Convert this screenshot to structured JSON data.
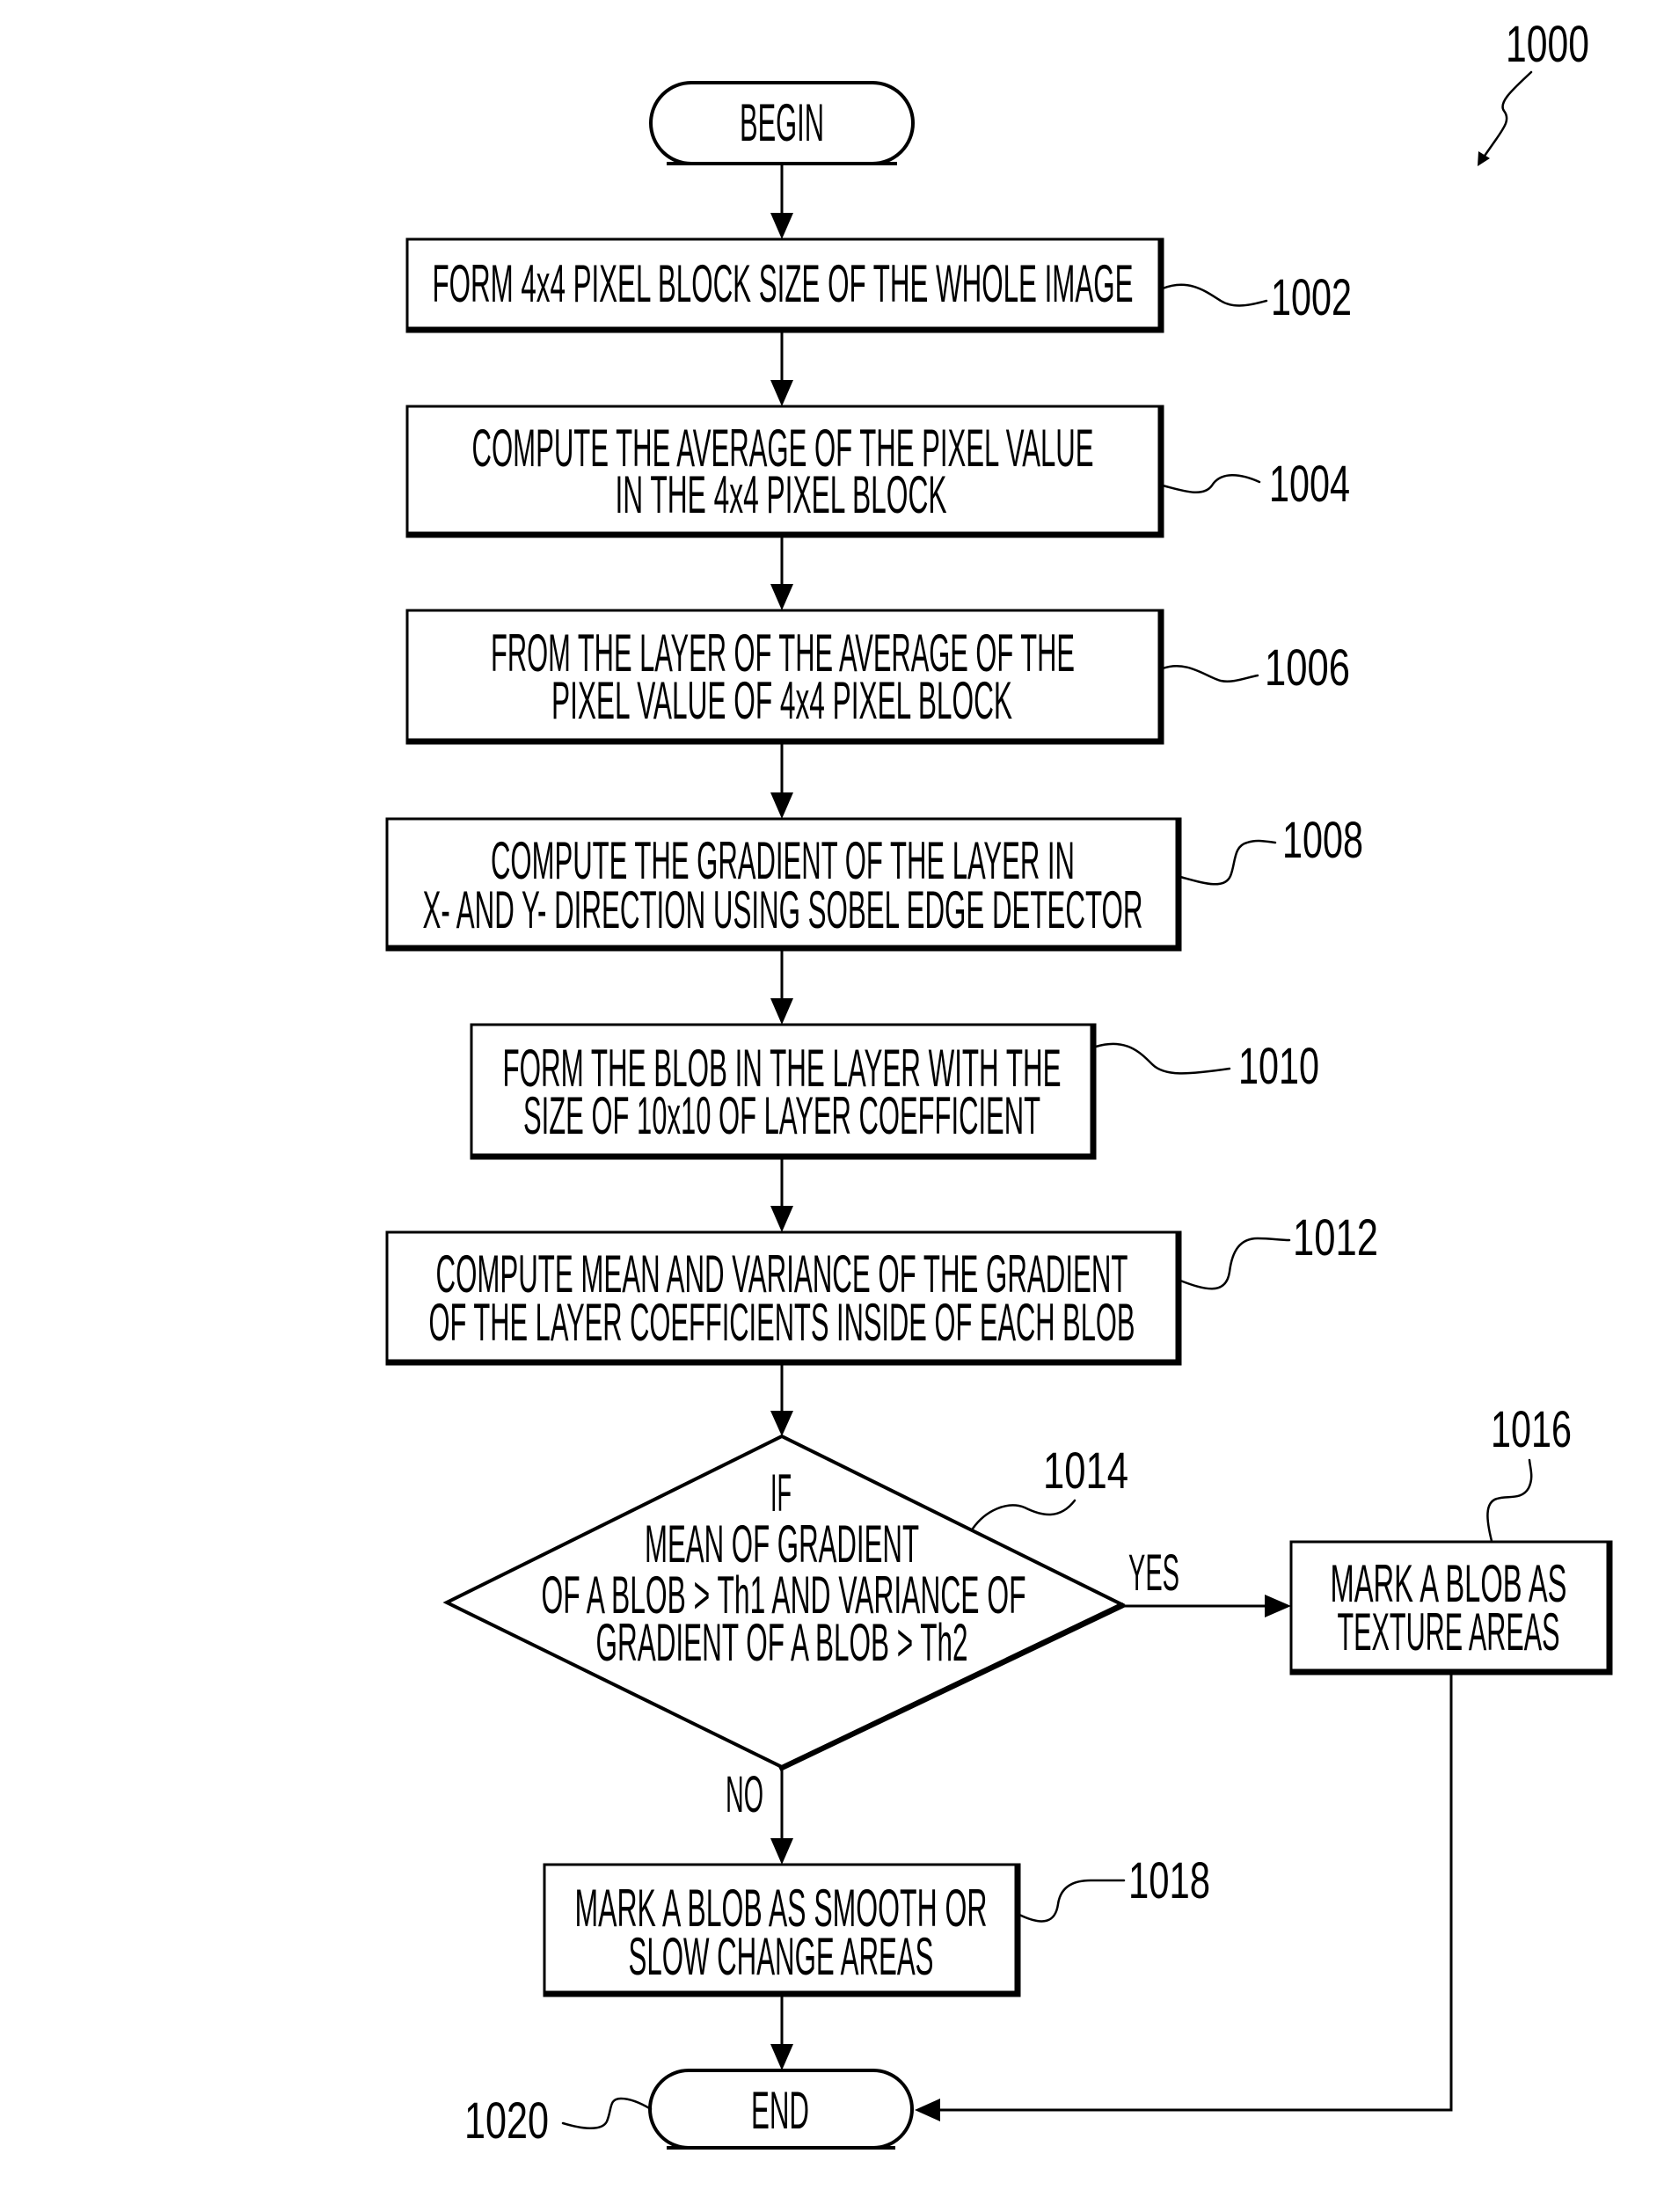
{
  "figure": {
    "reference": "1000",
    "colors": {
      "ink": "#000000",
      "paper": "#ffffff"
    }
  },
  "begin": {
    "label": "BEGIN"
  },
  "end": {
    "label": "END",
    "ref": "1020"
  },
  "steps": [
    {
      "ref": "1002",
      "lines": [
        "FORM 4x4 PIXEL BLOCK SIZE OF THE WHOLE IMAGE"
      ]
    },
    {
      "ref": "1004",
      "lines": [
        "COMPUTE THE AVERAGE OF THE PIXEL VALUE",
        "IN THE 4x4 PIXEL BLOCK"
      ]
    },
    {
      "ref": "1006",
      "lines": [
        "FROM THE LAYER OF THE AVERAGE OF THE",
        "PIXEL VALUE OF 4x4 PIXEL BLOCK"
      ]
    },
    {
      "ref": "1008",
      "lines": [
        "COMPUTE THE GRADIENT OF THE LAYER IN",
        "X- AND Y- DIRECTION USING SOBEL EDGE DETECTOR"
      ]
    },
    {
      "ref": "1010",
      "lines": [
        "FORM THE BLOB IN THE LAYER WITH THE",
        "SIZE OF 10x10 OF LAYER COEFFICIENT"
      ]
    },
    {
      "ref": "1012",
      "lines": [
        "COMPUTE MEAN AND VARIANCE OF THE GRADIENT",
        "OF THE LAYER COEFFICIENTS INSIDE OF EACH BLOB"
      ]
    }
  ],
  "decision": {
    "ref": "1014",
    "lines": [
      "IF",
      "MEAN OF GRADIENT",
      "OF A BLOB > Th1 AND VARIANCE OF",
      "GRADIENT OF A BLOB > Th2"
    ],
    "yes_label": "YES",
    "no_label": "NO"
  },
  "texture_step": {
    "ref": "1016",
    "lines": [
      "MARK A BLOB AS",
      "TEXTURE AREAS"
    ]
  },
  "smooth_step": {
    "ref": "1018",
    "lines": [
      "MARK A BLOB AS SMOOTH OR",
      "SLOW CHANGE AREAS"
    ]
  }
}
